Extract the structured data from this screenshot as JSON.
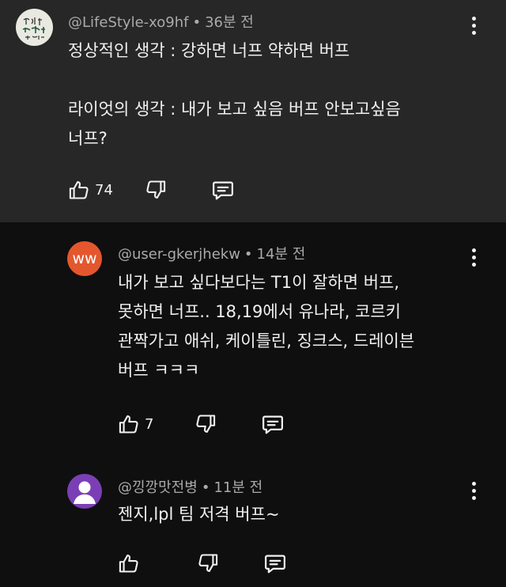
{
  "comments": [
    {
      "handle": "@LifeStyle-xo9hf",
      "time": "36분 전",
      "lines": [
        "정상적인 생각 : 강하면 너프 약하면 버프",
        "",
        "라이엇의 생각 : 내가 보고 싶음 버프 안보고싶음",
        "너프?"
      ],
      "likes": "74",
      "avatar_text": "인생도 꽃보다 아름다운 사람"
    },
    {
      "handle": "@user-gkerjhekw",
      "time": "14분 전",
      "lines": [
        "내가 보고 싶다보다는 T1이 잘하면 버프,",
        "못하면 너프.. 18,19에서 유나라, 코르키",
        "관짝가고 애쉬, 케이틀린, 징크스, 드레이븐",
        "버프 ㅋㅋㅋ"
      ],
      "likes": "7",
      "avatar_text": "ww",
      "avatar_color": "#e4572e"
    },
    {
      "handle": "@낑깡맛전병",
      "time": "11분 전",
      "lines": [
        "젠지,lpl 팀 저격 버프~"
      ],
      "likes": "",
      "avatar_color": "#7b3fb5"
    }
  ],
  "separator": "•",
  "icons": [
    "thumb-up-icon",
    "thumb-down-icon",
    "reply-icon",
    "more-vert-icon"
  ]
}
